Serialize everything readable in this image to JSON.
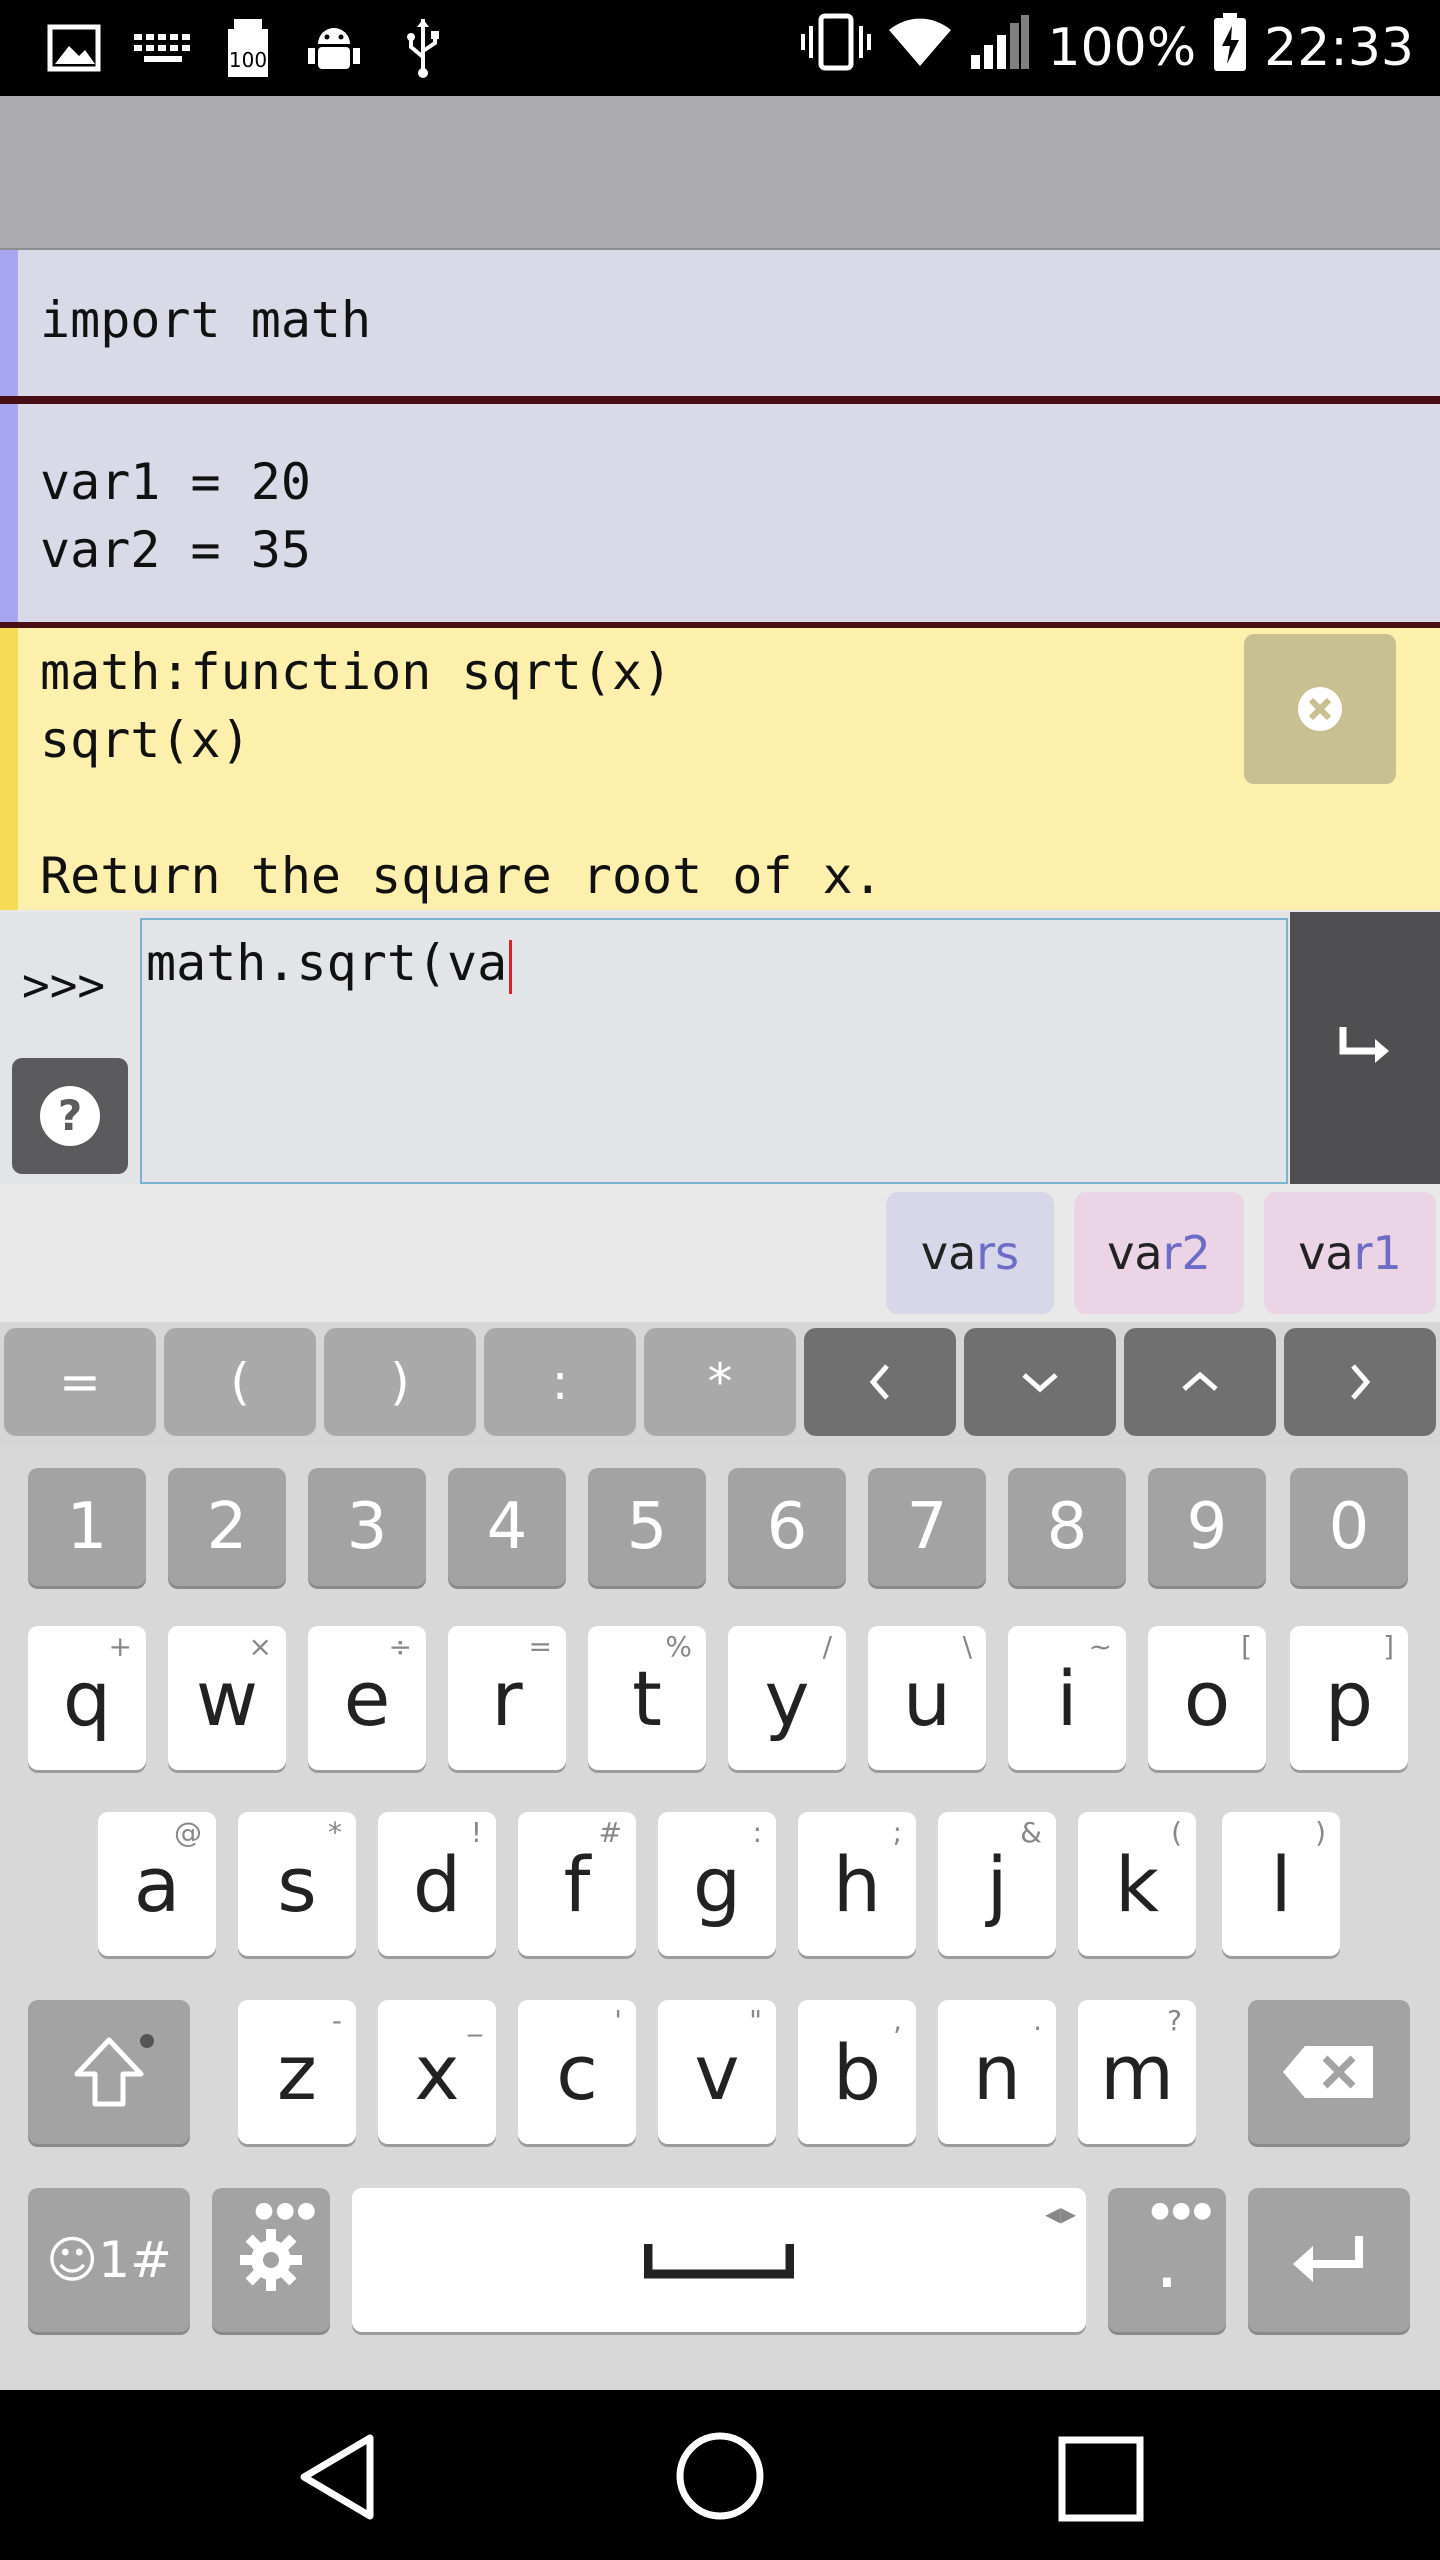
{
  "status_bar": {
    "battery_percent": "100%",
    "time": "22:33",
    "icons": [
      "image-icon",
      "keyboard-icon",
      "sd-100-icon",
      "android-debug-icon",
      "usb-icon",
      "vibrate-icon",
      "wifi-icon",
      "signal-icon",
      "battery-charging-icon"
    ]
  },
  "cells": [
    {
      "text": "import math"
    },
    {
      "text": "var1 = 20\nvar2 = 35"
    }
  ],
  "doc_popup": {
    "text": "math:function sqrt(x)\nsqrt(x)\n\nReturn the square root of x."
  },
  "console": {
    "prompt": ">>>",
    "input_value": "math.sqrt(va"
  },
  "suggestions": [
    {
      "typed": "va",
      "rest": "rs"
    },
    {
      "typed": "va",
      "rest": "r2"
    },
    {
      "typed": "va",
      "rest": "r1"
    }
  ],
  "extra_row": [
    "=",
    "(",
    ")",
    ":",
    "*"
  ],
  "number_row": [
    "1",
    "2",
    "3",
    "4",
    "5",
    "6",
    "7",
    "8",
    "9",
    "0"
  ],
  "row_q": [
    {
      "k": "q",
      "s": "+"
    },
    {
      "k": "w",
      "s": "×"
    },
    {
      "k": "e",
      "s": "÷"
    },
    {
      "k": "r",
      "s": "="
    },
    {
      "k": "t",
      "s": "%"
    },
    {
      "k": "y",
      "s": "/"
    },
    {
      "k": "u",
      "s": "\\"
    },
    {
      "k": "i",
      "s": "~"
    },
    {
      "k": "o",
      "s": "["
    },
    {
      "k": "p",
      "s": "]"
    }
  ],
  "row_a": [
    {
      "k": "a",
      "s": "@"
    },
    {
      "k": "s",
      "s": "*"
    },
    {
      "k": "d",
      "s": "!"
    },
    {
      "k": "f",
      "s": "#"
    },
    {
      "k": "g",
      "s": ":"
    },
    {
      "k": "h",
      "s": ";"
    },
    {
      "k": "j",
      "s": "&"
    },
    {
      "k": "k",
      "s": "("
    },
    {
      "k": "l",
      "s": ")"
    }
  ],
  "row_z": [
    {
      "k": "z",
      "s": "-"
    },
    {
      "k": "x",
      "s": "_"
    },
    {
      "k": "c",
      "s": "'"
    },
    {
      "k": "v",
      "s": "\""
    },
    {
      "k": "b",
      "s": ","
    },
    {
      "k": "n",
      "s": "."
    },
    {
      "k": "m",
      "s": "?"
    }
  ],
  "bottom_row": {
    "symbols_label": "☺1#",
    "period_label": "."
  }
}
